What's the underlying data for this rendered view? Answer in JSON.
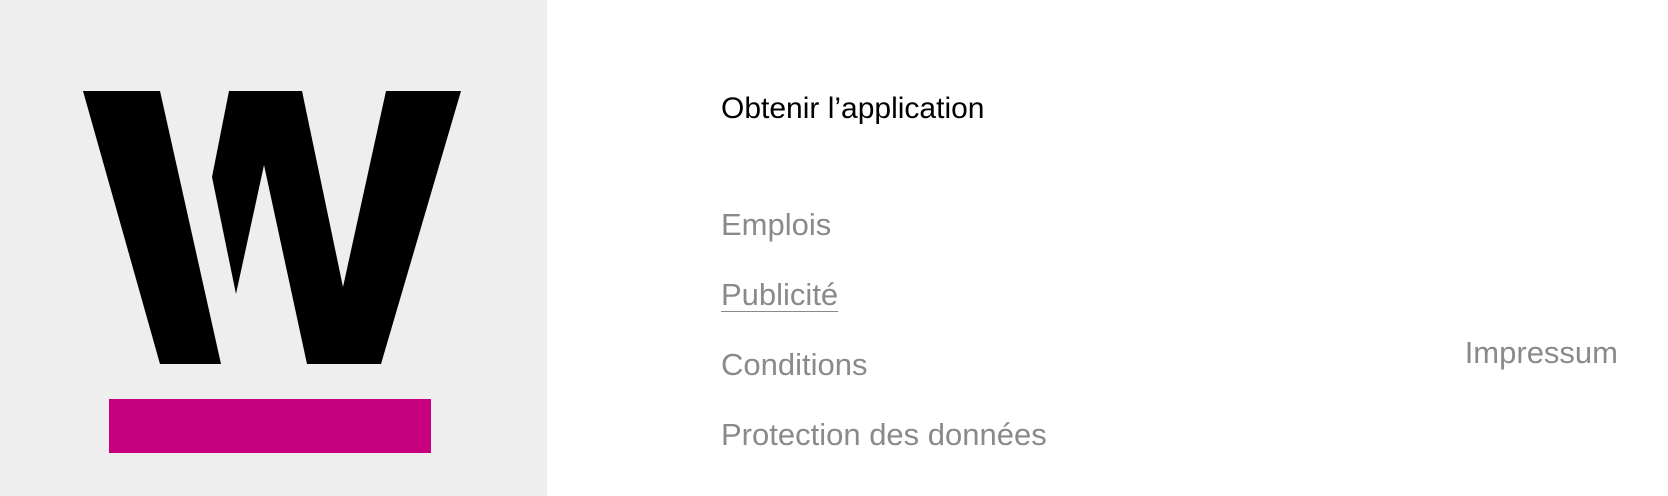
{
  "brand": {
    "logo_icon": "w-logo-icon",
    "panel_color": "#eeeeee",
    "logo_color": "#000000",
    "accent_color": "#c6007e"
  },
  "footer": {
    "get_app_label": "Obtenir l’application",
    "links": [
      {
        "label": "Emplois"
      },
      {
        "label": "Publicité",
        "active": true
      },
      {
        "label": "Conditions"
      },
      {
        "label": "Protection des données"
      }
    ],
    "impressum_label": "Impressum"
  },
  "colors": {
    "primary_text": "#000000",
    "secondary_text": "#8a8a8a"
  }
}
